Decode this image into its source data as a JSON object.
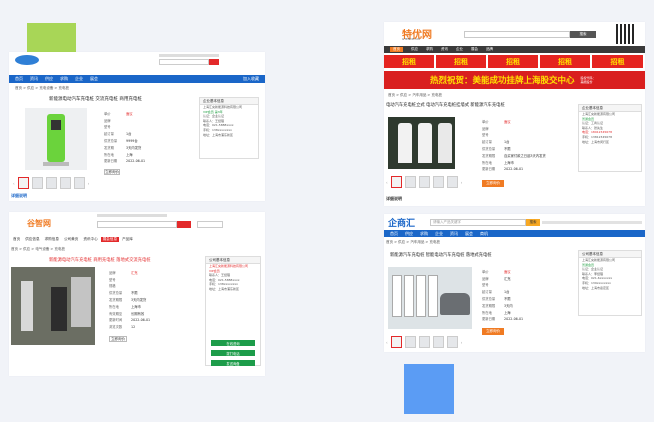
{
  "colors": {
    "page_bg": "#f1f3f8",
    "square_green": "#a8d657",
    "square_blue": "#5b9cf4",
    "nav_blue": "#1a66c8",
    "brand_red": "#e3292a",
    "orange": "#f07b23",
    "ad_red": "#e52420",
    "ad_yellow": "#ffe100"
  },
  "s1": {
    "nav": [
      "首页",
      "资讯",
      "供应",
      "求购",
      "企业",
      "展会"
    ],
    "right_nav": "加入收藏",
    "breadcrumb": "首页 > 供应 > 充电设备 > 充电桩",
    "title": "新能源电动汽车充电桩 交流充电桩 商用充电桩",
    "specs": [
      [
        "单价",
        "面议"
      ],
      [
        "品牌",
        ""
      ],
      [
        "型号",
        ""
      ],
      [
        "起订量",
        "1台"
      ],
      [
        "供货总量",
        "9999台"
      ],
      [
        "发货期",
        "3天内发货"
      ],
      [
        "所在地",
        "上海"
      ],
      [
        "更新日期",
        "2022-06-01"
      ]
    ],
    "side_head": "企业基本信息",
    "side_rows": [
      "上海汇充新能源科技有限公司",
      "VIP会员 第3年",
      "认证：企业认证",
      "联系人：王经理",
      "电话：021-5888xxxx",
      "手机：138xxxxxxxx",
      "地址：上海市浦东新区"
    ],
    "contact_btn": "立即询价",
    "section": "详细说明"
  },
  "s2": {
    "logo": "特优网",
    "logo_sub": "GTENDE.CN",
    "search_btn": "搜索",
    "cats": [
      "首页",
      "供应",
      "求购",
      "资讯",
      "企业",
      "展会",
      "品牌"
    ],
    "ads": [
      "招租",
      "招租",
      "招租",
      "招租",
      "招租"
    ],
    "banner": "热烈祝贺：美能成功挂牌上海股交中心",
    "banner_side": [
      "股权代码：",
      "美能股份"
    ],
    "breadcrumb": "首页 > 供应 > 汽车用品 > 充电桩",
    "title": "电动汽车充电桩立式 电动汽车充电桩挂墙式 新能源汽车充电桩",
    "specs": [
      [
        "单价",
        "面议"
      ],
      [
        "品牌",
        ""
      ],
      [
        "型号",
        ""
      ],
      [
        "起订量",
        "1台"
      ],
      [
        "供货总量",
        "不限"
      ],
      [
        "发货期限",
        "自买家付款之日起3天内发货"
      ],
      [
        "所在地",
        "上海市"
      ],
      [
        "更新日期",
        "2022-06-01"
      ]
    ],
    "contact_btn": "立即询价",
    "side_head": "企业基本信息",
    "side_rows": [
      "上海汇充新能源有限公司",
      "普通会员",
      "认证：工商认证",
      "联系人：张先生",
      "电话：18912345678",
      "手机：13812345678",
      "地址：上海市闵行区"
    ],
    "section": "详细说明"
  },
  "s3": {
    "logo": "谷智网",
    "tabs": [
      "首页",
      "供应信息",
      "求购信息",
      "公司黄页",
      "资讯中心",
      "展会信息",
      "产品库"
    ],
    "active_tab": 5,
    "breadcrumb": "首页 > 供应 > 电气设备 > 充电桩",
    "title": "新能源电动汽车充电桩 商用充电桩 落地式交流充电桩",
    "specs": [
      [
        "品牌",
        "汇充"
      ],
      [
        "型号",
        ""
      ],
      [
        "规格",
        ""
      ],
      [
        "供货总量",
        "不限"
      ],
      [
        "发货期限",
        "3天内发货"
      ],
      [
        "所在地",
        "上海市"
      ],
      [
        "有效期至",
        "长期有效"
      ],
      [
        "更新时间",
        "2022-06-01"
      ],
      [
        "浏览次数",
        "12"
      ]
    ],
    "contact_btn": "立即询价",
    "side_head": "公司基本信息",
    "side_rows": [
      "上海汇充新能源科技有限公司",
      "VIP会员",
      "联系人：王经理",
      "电话：021-5888xxxx",
      "手机：138xxxxxxxx",
      "地址：上海市浦东新区"
    ],
    "green_btns": [
      "在线咨询",
      "拨打电话",
      "发送询盘"
    ]
  },
  "s4": {
    "logo": "企商汇",
    "search_placeholder": "请输入产品关键字",
    "search_btn": "搜索",
    "nav": [
      "首页",
      "供应",
      "求购",
      "企业",
      "资讯",
      "展会",
      "商机"
    ],
    "breadcrumb": "首页 > 供应 > 汽车用品 > 充电桩",
    "title": "新能源汽车充电桩 智能电动汽车充电桩 落地式充电桩",
    "specs": [
      [
        "单价",
        "面议"
      ],
      [
        "品牌",
        "汇充"
      ],
      [
        "型号",
        ""
      ],
      [
        "起订量",
        "1台"
      ],
      [
        "供货总量",
        "不限"
      ],
      [
        "发货期限",
        "3天内"
      ],
      [
        "所在地",
        "上海"
      ],
      [
        "更新日期",
        "2022-06-01"
      ]
    ],
    "contact_btn": "立即询价",
    "side_head": "公司基本信息",
    "side_rows": [
      "上海汇充新能源有限公司",
      "普通会员",
      "认证：企业认证",
      "联系人：李经理",
      "电话：021-6xxxxxxx",
      "手机：139xxxxxxxx",
      "地址：上海市嘉定区"
    ]
  }
}
